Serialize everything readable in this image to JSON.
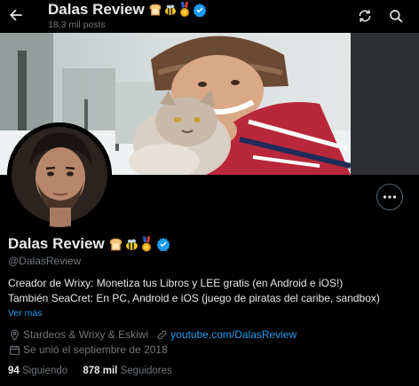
{
  "header": {
    "back_icon": "arrow-left-icon",
    "title": "Dalas Review",
    "title_emojis": [
      "bread-emoji",
      "bee-emoji",
      "medal-emoji"
    ],
    "posts_count": "18,3 mil posts",
    "refresh_icon": "refresh-icon",
    "search_icon": "search-icon"
  },
  "profile": {
    "more_icon": "more-horizontal-icon",
    "name": "Dalas Review",
    "verified_color": "#1d9bf0",
    "handle": "@DalasReview",
    "bio_line1": "Creador de Wrixy: Monetiza tus Libros y LEE gratis (en Android e iOS!)",
    "bio_line2": "También SeaCret: En PC, Android e iOS (juego de piratas del caribe, sandbox)",
    "see_more": "Ver más",
    "location": "Stardeos & Wrixy & Eskiwi",
    "website": "youtube.com/DalasReview",
    "joined": "Se unió el septiembre de 2018",
    "following_count": "94",
    "following_label": "Siguiendo",
    "followers_count": "878 mil",
    "followers_label": "Seguidores"
  },
  "colors": {
    "accent": "#1d9bf0",
    "text": "#e7e9ea",
    "muted": "#71767b",
    "background": "#000000"
  }
}
